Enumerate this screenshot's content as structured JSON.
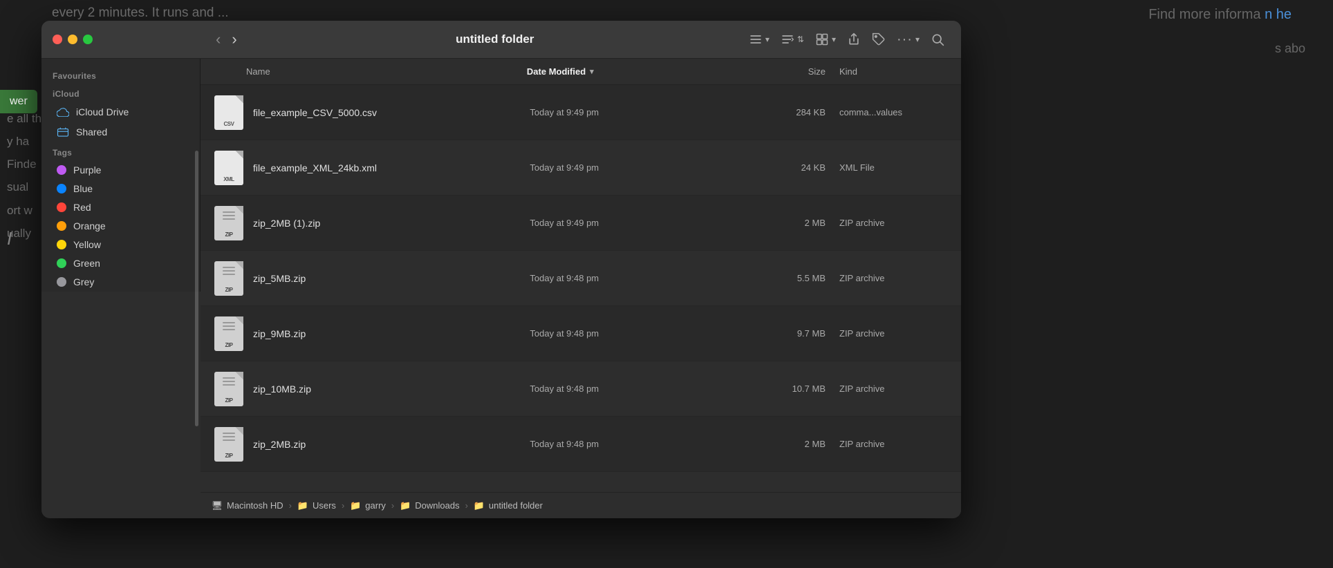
{
  "background": {
    "top_text": "every 2 minutes. It runs and ...",
    "top_right": "Find more informa",
    "blue_text": "n he",
    "right_label": "s abo",
    "left_lines": [
      "e all the",
      "y ha",
      "Finde",
      "sual",
      "ort w",
      "ually"
    ],
    "green_btn": "wer"
  },
  "window": {
    "title": "untitled folder",
    "nav": {
      "back_label": "‹",
      "forward_label": "›"
    },
    "toolbar": {
      "list_view": "☰",
      "grid_view": "⊞",
      "share": "↑",
      "tag": "◇",
      "more": "···",
      "search": "⌕"
    }
  },
  "sidebar": {
    "favourites_header": "Favourites",
    "icloud_header": "iCloud",
    "tags_header": "Tags",
    "items": {
      "icloud_drive": "iCloud Drive",
      "shared": "Shared"
    },
    "tags": [
      {
        "name": "Purple",
        "color": "#bf5af2"
      },
      {
        "name": "Blue",
        "color": "#0a84ff"
      },
      {
        "name": "Red",
        "color": "#ff453a"
      },
      {
        "name": "Orange",
        "color": "#ff9f0a"
      },
      {
        "name": "Yellow",
        "color": "#ffd60a"
      },
      {
        "name": "Green",
        "color": "#30d158"
      },
      {
        "name": "Grey",
        "color": "#98989d"
      }
    ]
  },
  "columns": {
    "name": "Name",
    "date_modified": "Date Modified",
    "size": "Size",
    "kind": "Kind"
  },
  "files": [
    {
      "name": "file_example_CSV_5000.csv",
      "date": "Today at 9:49 pm",
      "size": "284 KB",
      "kind": "comma...values",
      "type": "csv"
    },
    {
      "name": "file_example_XML_24kb.xml",
      "date": "Today at 9:49 pm",
      "size": "24 KB",
      "kind": "XML File",
      "type": "xml"
    },
    {
      "name": "zip_2MB (1).zip",
      "date": "Today at 9:49 pm",
      "size": "2 MB",
      "kind": "ZIP archive",
      "type": "zip"
    },
    {
      "name": "zip_5MB.zip",
      "date": "Today at 9:48 pm",
      "size": "5.5 MB",
      "kind": "ZIP archive",
      "type": "zip"
    },
    {
      "name": "zip_9MB.zip",
      "date": "Today at 9:48 pm",
      "size": "9.7 MB",
      "kind": "ZIP archive",
      "type": "zip"
    },
    {
      "name": "zip_10MB.zip",
      "date": "Today at 9:48 pm",
      "size": "10.7 MB",
      "kind": "ZIP archive",
      "type": "zip"
    },
    {
      "name": "zip_2MB.zip",
      "date": "Today at 9:48 pm",
      "size": "2 MB",
      "kind": "ZIP archive",
      "type": "zip"
    }
  ],
  "breadcrumb": [
    {
      "label": "Macintosh HD",
      "icon": "💾",
      "type": "disk"
    },
    {
      "label": "Users",
      "icon": "📁",
      "type": "folder"
    },
    {
      "label": "garry",
      "icon": "📁",
      "type": "folder"
    },
    {
      "label": "Downloads",
      "icon": "📁",
      "type": "folder"
    },
    {
      "label": "untitled folder",
      "icon": "📁",
      "type": "folder"
    }
  ]
}
